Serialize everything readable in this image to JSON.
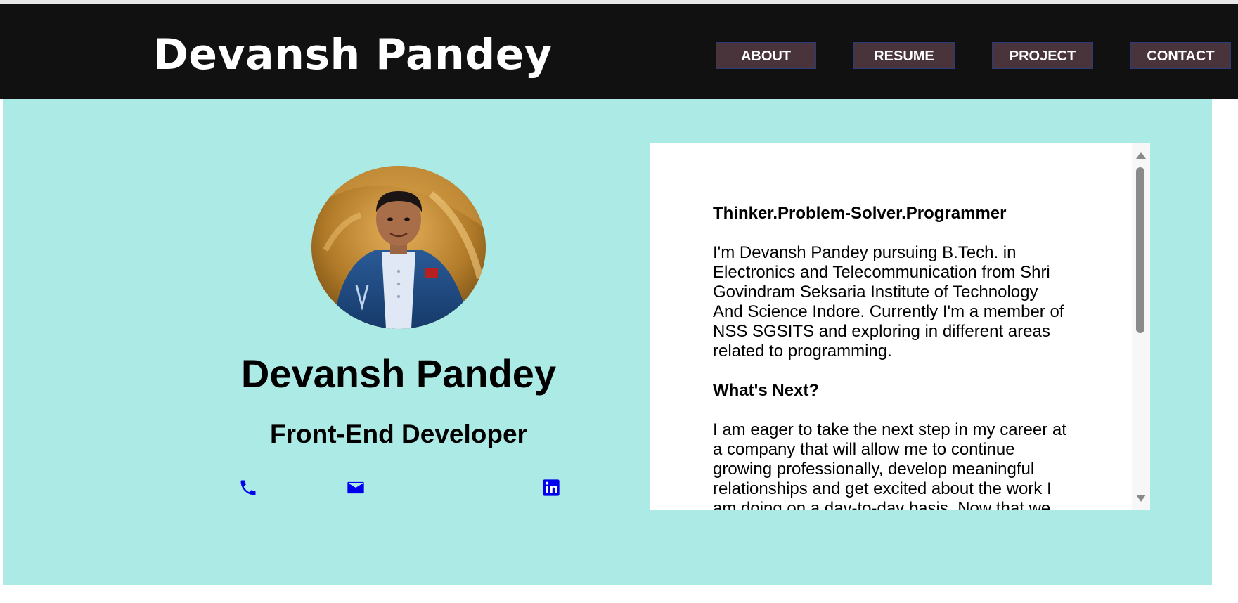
{
  "header": {
    "brand": "Devansh Pandey",
    "nav": [
      {
        "label": "ABOUT"
      },
      {
        "label": "RESUME"
      },
      {
        "label": "PROJECT"
      },
      {
        "label": "CONTACT"
      }
    ],
    "background": "#111111",
    "button_color": "#4a343c"
  },
  "profile": {
    "name": "Devansh Pandey",
    "role": "Front-End Developer",
    "social_icons": [
      "phone-icon",
      "email-icon",
      "linkedin-icon"
    ],
    "icon_color": "#0000ee"
  },
  "about": {
    "tagline": "Thinker.Problem-Solver.Programmer",
    "intro": "I'm Devansh Pandey pursuing B.Tech. in Electronics and Telecommunication from Shri Govindram Seksaria Institute of Technology And Science Indore. Currently I'm a member of NSS SGSITS and exploring in different areas related to programming.",
    "next_heading": "What's Next?",
    "next_text": "I am eager to take the next step in my career at a company that will allow me to continue growing professionally, develop meaningful relationships and get excited about the work I am doing on a day-to-day basis. Now that we"
  },
  "hero": {
    "background": "#aceae6"
  }
}
